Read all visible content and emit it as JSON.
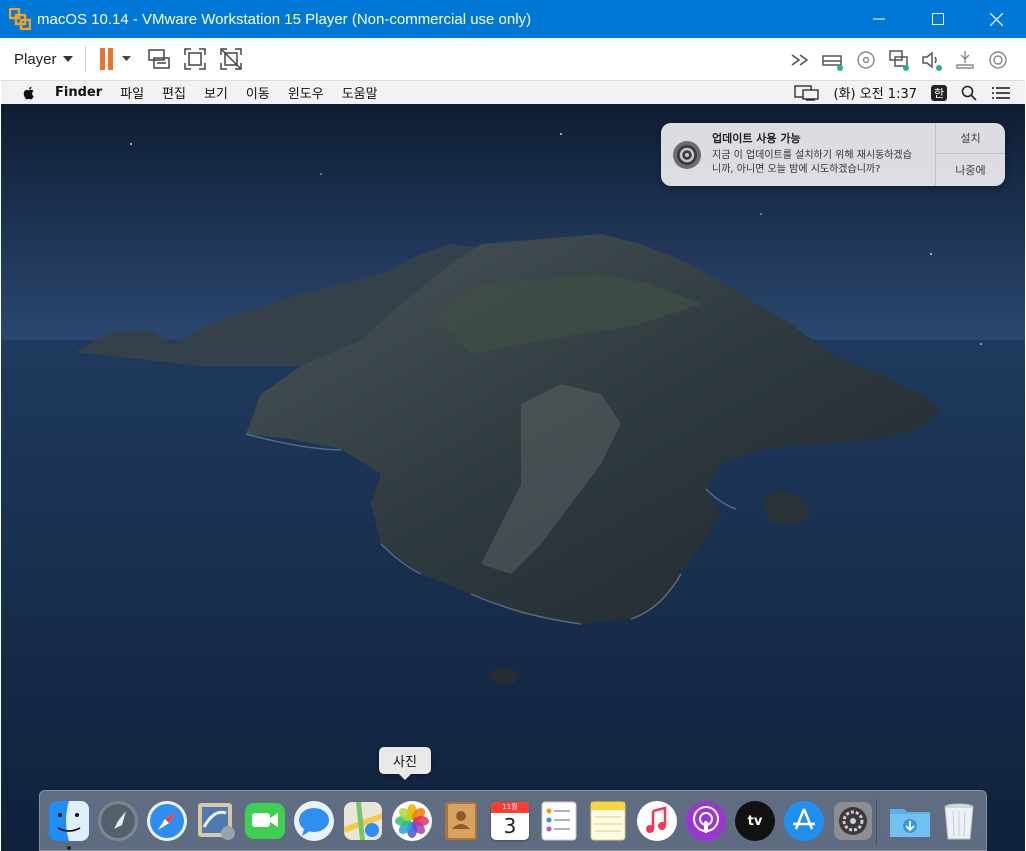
{
  "window": {
    "title": "macOS 10.14 - VMware Workstation 15 Player (Non-commercial use only)",
    "controls": [
      "minimize-icon",
      "maximize-icon",
      "close-icon"
    ]
  },
  "vmware_toolbar": {
    "player_menu": "Player",
    "left_tools": [
      "pause-icon",
      "send-ctrl-alt-del-icon",
      "full-screen-icon",
      "unity-icon"
    ],
    "right_tools": [
      "more-icon",
      "hard-disk-icon",
      "cd-dvd-icon",
      "network-icon",
      "sound-icon",
      "usb-icon",
      "display-icon"
    ]
  },
  "mac_menu": {
    "app_name": "Finder",
    "items": [
      "파일",
      "편집",
      "보기",
      "이동",
      "윈도우",
      "도움말"
    ],
    "clock": "(화) 오전 1:37",
    "input_source": "한"
  },
  "notification": {
    "title": "업데이트 사용 가능",
    "text_line1": "지금 이 업데이트를 설치하기 위해 재시동하겠습",
    "text_line2": "니까, 아니면 오늘 밤에 시도하겠습니까?",
    "install_label": "설치",
    "later_label": "나중에"
  },
  "dock": {
    "tooltip": "사진",
    "calendar_month": "11월",
    "calendar_day": "3",
    "apps": [
      "Finder",
      "Launchpad",
      "Safari",
      "Mail",
      "FaceTime",
      "Messages",
      "Maps",
      "Photos",
      "Contacts",
      "Calendar",
      "Reminders",
      "Notes",
      "Music",
      "Podcasts",
      "TV",
      "App Store",
      "System Preferences",
      "Downloads",
      "Trash"
    ],
    "tv_label": "tv"
  },
  "colors": {
    "titlebar": "#0078d7",
    "pause_orange": "#e8742c",
    "sea": "#1d3556"
  }
}
